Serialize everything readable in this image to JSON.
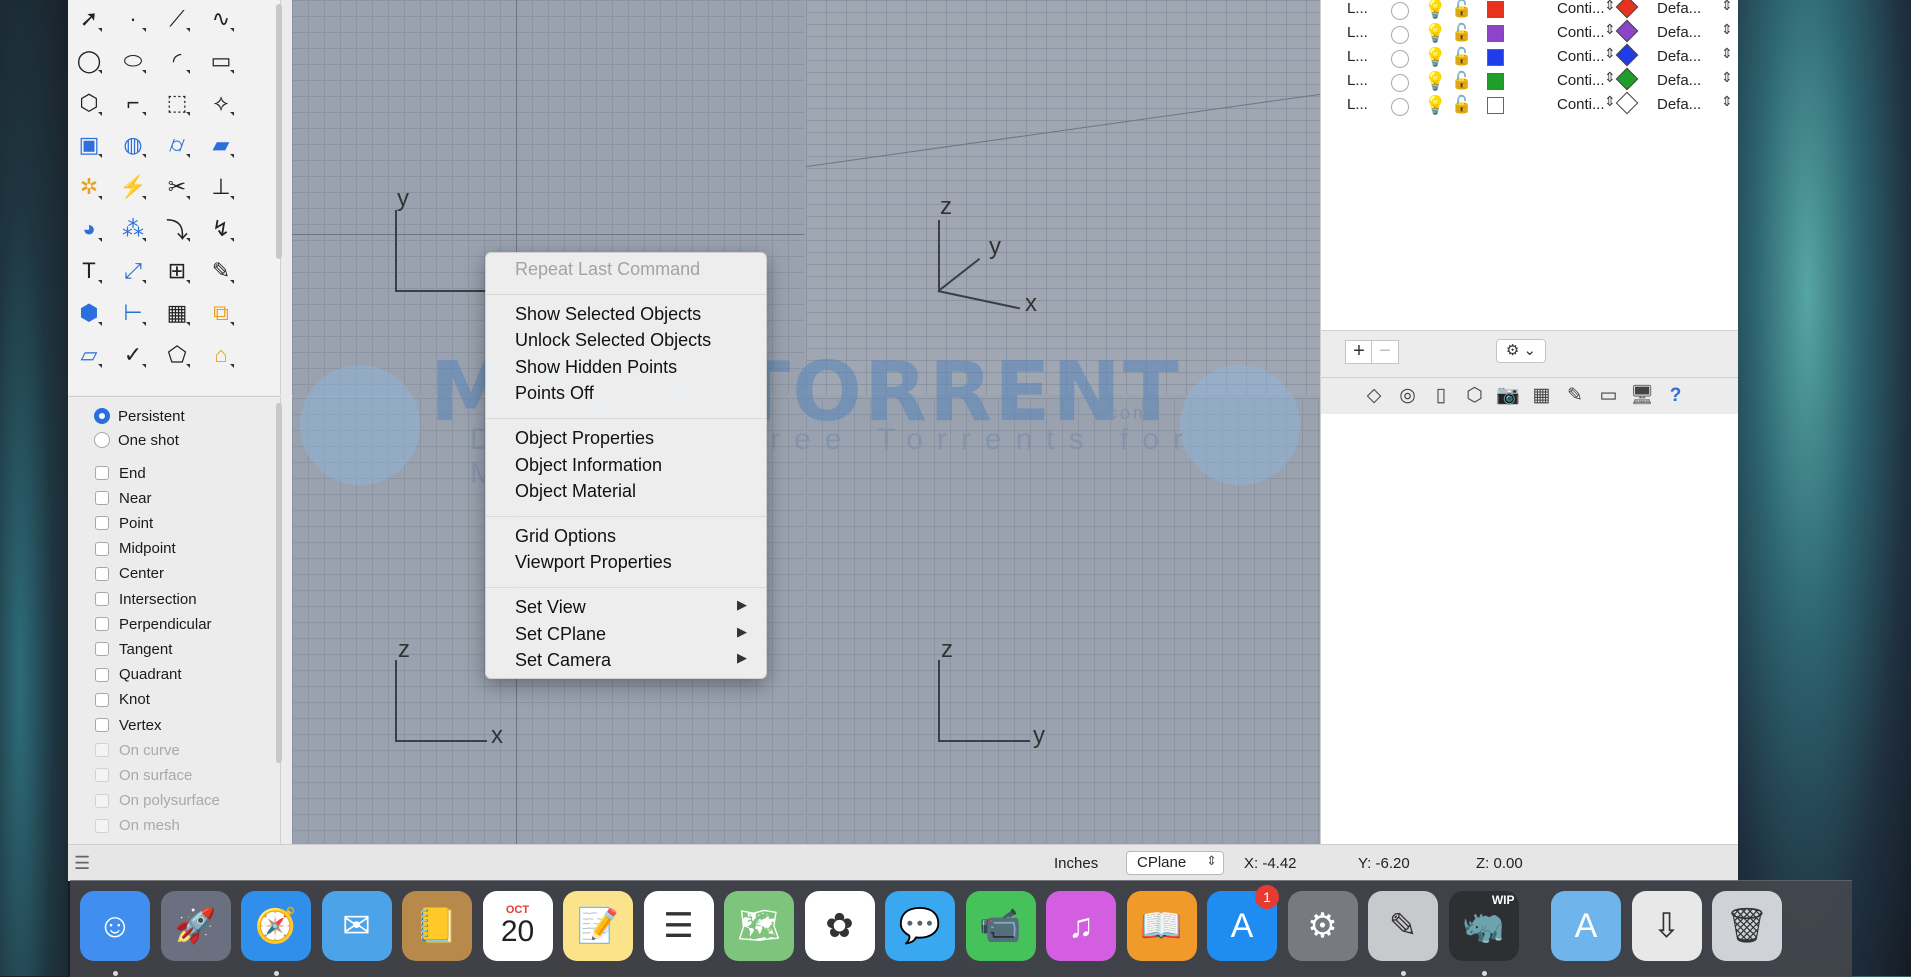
{
  "toolbox": {
    "tools": [
      [
        "select-arrow-icon",
        "point-icon",
        "polyline-icon",
        "curve-icon"
      ],
      [
        "circle-icon",
        "ellipse-icon",
        "arc-icon",
        "rectangle-icon"
      ],
      [
        "polygon-icon",
        "fillet-icon",
        "surface-pt-icon",
        "sweep-icon"
      ],
      [
        "box-icon",
        "sphere-icon",
        "cylinder-icon",
        "plane-surface-icon"
      ],
      [
        "gear-puzzle-icon",
        "explode-icon",
        "trim-icon",
        "split-icon"
      ],
      [
        "boolean-icon",
        "group-icon",
        "rebuild-icon",
        "curve-edit-icon"
      ],
      [
        "text-icon",
        "scale-icon",
        "array-icon",
        "edit-icon"
      ],
      [
        "solid-edit-icon",
        "dimension-icon",
        "grid-array-icon",
        "mirror-icon"
      ],
      [
        "extrude-icon",
        "check-icon",
        "mesh-icon",
        "orient-icon"
      ]
    ]
  },
  "osnap": {
    "mode_options": [
      {
        "label": "Persistent",
        "selected": true
      },
      {
        "label": "One shot",
        "selected": false
      }
    ],
    "items": [
      {
        "label": "End",
        "enabled": true
      },
      {
        "label": "Near",
        "enabled": true
      },
      {
        "label": "Point",
        "enabled": true
      },
      {
        "label": "Midpoint",
        "enabled": true
      },
      {
        "label": "Center",
        "enabled": true
      },
      {
        "label": "Intersection",
        "enabled": true
      },
      {
        "label": "Perpendicular",
        "enabled": true
      },
      {
        "label": "Tangent",
        "enabled": true
      },
      {
        "label": "Quadrant",
        "enabled": true
      },
      {
        "label": "Knot",
        "enabled": true
      },
      {
        "label": "Vertex",
        "enabled": true
      },
      {
        "label": "On curve",
        "enabled": false
      },
      {
        "label": "On surface",
        "enabled": false
      },
      {
        "label": "On polysurface",
        "enabled": false
      },
      {
        "label": "On mesh",
        "enabled": false
      }
    ]
  },
  "viewports": {
    "top": {
      "x_label": "",
      "y_label": "y"
    },
    "perspective": {
      "x_label": "x",
      "y_label": "y",
      "z_label": "z"
    },
    "front": {
      "h_label": "x",
      "v_label": "z"
    },
    "right": {
      "h_label": "y",
      "v_label": "z"
    }
  },
  "watermark": {
    "title": "MACS TORRENT",
    "subtitle": "Download Free Torrents for Mac",
    "domain": ".com"
  },
  "context_menu": {
    "groups": [
      [
        {
          "label": "Repeat Last Command",
          "enabled": false
        }
      ],
      [
        {
          "label": "Show Selected Objects",
          "enabled": true
        },
        {
          "label": "Unlock Selected Objects",
          "enabled": true
        },
        {
          "label": "Show Hidden Points",
          "enabled": true
        },
        {
          "label": "Points Off",
          "enabled": true
        }
      ],
      [
        {
          "label": "Object Properties",
          "enabled": true
        },
        {
          "label": "Object Information",
          "enabled": true
        },
        {
          "label": "Object Material",
          "enabled": true
        }
      ],
      [
        {
          "label": "Grid Options",
          "enabled": true
        },
        {
          "label": "Viewport Properties",
          "enabled": true
        }
      ],
      [
        {
          "label": "Set View",
          "enabled": true,
          "submenu": true
        },
        {
          "label": "Set CPlane",
          "enabled": true,
          "submenu": true
        },
        {
          "label": "Set Camera",
          "enabled": true,
          "submenu": true
        }
      ]
    ]
  },
  "layers": {
    "rows": [
      {
        "name": "L...",
        "color": "#e8321f",
        "linetype": "Conti...",
        "material_color": "#e8321f",
        "print": "Defa..."
      },
      {
        "name": "L...",
        "color": "#8e44c8",
        "linetype": "Conti...",
        "material_color": "#8e44c8",
        "print": "Defa..."
      },
      {
        "name": "L...",
        "color": "#1f3ce8",
        "linetype": "Conti...",
        "material_color": "#1f3ce8",
        "print": "Defa..."
      },
      {
        "name": "L...",
        "color": "#1e9e2a",
        "linetype": "Conti...",
        "material_color": "#1e9e2a",
        "print": "Defa..."
      },
      {
        "name": "L...",
        "color": "#ffffff",
        "linetype": "Conti...",
        "material_color": "#ffffff",
        "print": "Defa..."
      }
    ],
    "add_label": "+",
    "remove_label": "−",
    "gear_label": "⚙ ⌄"
  },
  "inspector_tabs": [
    "layers-icon",
    "object-icon",
    "document-icon",
    "cube-icon",
    "camera-icon",
    "grid-icon",
    "notes-icon",
    "viewport-icon",
    "display-icon",
    "help-icon"
  ],
  "status": {
    "units": "Inches",
    "cplane": "CPlane",
    "x": "X: -4.42",
    "y": "Y: -6.20",
    "z": "Z: 0.00"
  },
  "dock": {
    "items": [
      {
        "name": "finder-icon",
        "glyph": "☺",
        "bg": "#3f8ef0"
      },
      {
        "name": "launchpad-icon",
        "glyph": "🚀",
        "bg": "#6b7080"
      },
      {
        "name": "safari-icon",
        "glyph": "🧭",
        "bg": "#2f8fea"
      },
      {
        "name": "mail-icon",
        "glyph": "✉",
        "bg": "#4da3e8"
      },
      {
        "name": "contacts-icon",
        "glyph": "📒",
        "bg": "#b7894b"
      },
      {
        "name": "calendar-icon",
        "glyph": "20",
        "bg": "#ffffff",
        "month": "OCT"
      },
      {
        "name": "notes-icon",
        "glyph": "📝",
        "bg": "#fbe38c"
      },
      {
        "name": "reminders-icon",
        "glyph": "☰",
        "bg": "#ffffff"
      },
      {
        "name": "maps-icon",
        "glyph": "🗺",
        "bg": "#7fc47d"
      },
      {
        "name": "photos-icon",
        "glyph": "✿",
        "bg": "#ffffff"
      },
      {
        "name": "messages-icon",
        "glyph": "💬",
        "bg": "#3aa8f0"
      },
      {
        "name": "facetime-icon",
        "glyph": "📹",
        "bg": "#45c25a"
      },
      {
        "name": "itunes-icon",
        "glyph": "♫",
        "bg": "#d35ee0"
      },
      {
        "name": "ibooks-icon",
        "glyph": "📖",
        "bg": "#f09a2a"
      },
      {
        "name": "app-store-icon",
        "glyph": "A",
        "bg": "#1e8cf0",
        "badge": "1"
      },
      {
        "name": "system-preferences-icon",
        "glyph": "⚙",
        "bg": "#777a80"
      },
      {
        "name": "grapher-icon",
        "glyph": "✎",
        "bg": "#c7c9cc"
      },
      {
        "name": "rhino-wip-icon",
        "glyph": "🦏",
        "bg": "#2d2f33",
        "label": "WIP"
      },
      {
        "name": "applications-folder-icon",
        "glyph": "A",
        "bg": "#6fb4ea"
      },
      {
        "name": "downloads-icon",
        "glyph": "⇩",
        "bg": "#e8e8e8"
      },
      {
        "name": "trash-icon",
        "glyph": "🗑",
        "bg": "#cfd2d6"
      }
    ]
  }
}
